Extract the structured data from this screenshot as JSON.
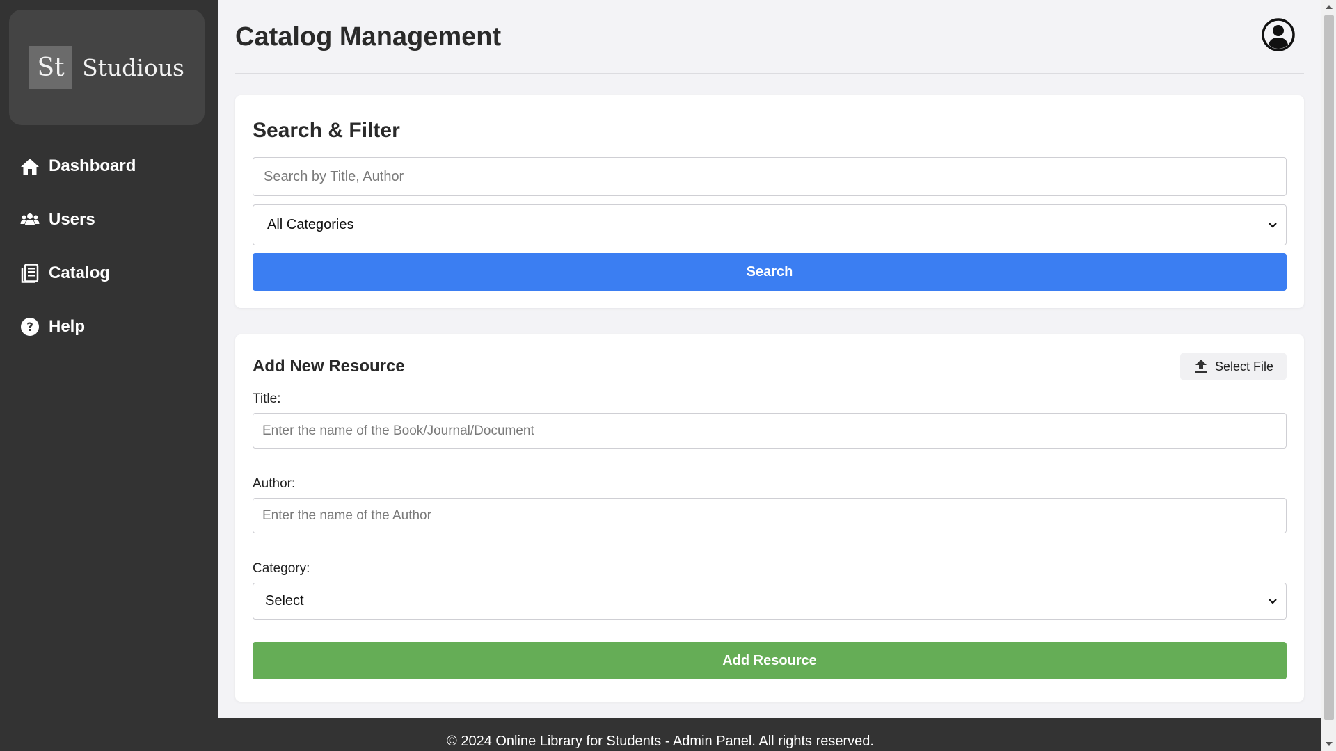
{
  "brand": {
    "mark": "St",
    "name": "Studious"
  },
  "sidebar": {
    "items": [
      {
        "label": "Dashboard",
        "icon": "home-icon"
      },
      {
        "label": "Users",
        "icon": "users-icon"
      },
      {
        "label": "Catalog",
        "icon": "catalog-icon"
      },
      {
        "label": "Help",
        "icon": "help-icon"
      }
    ]
  },
  "header": {
    "title": "Catalog Management",
    "profile_icon": "user-circle-icon"
  },
  "search": {
    "title": "Search & Filter",
    "placeholder": "Search by Title, Author",
    "category_selected": "All Categories",
    "button_label": "Search"
  },
  "add": {
    "title": "Add New Resource",
    "file_button_label": "Select File",
    "title_label": "Title:",
    "title_placeholder": "Enter the name of the Book/Journal/Document",
    "author_label": "Author:",
    "author_placeholder": "Enter the name of the Author",
    "category_label": "Category:",
    "category_selected": "Select",
    "button_label": "Add Resource"
  },
  "footer": {
    "text": "© 2024 Online Library for Students - Admin Panel. All rights reserved."
  },
  "colors": {
    "sidebar": "#333333",
    "primary": "#3b7ef2",
    "success": "#65ad56",
    "background": "#f3f3f6"
  }
}
